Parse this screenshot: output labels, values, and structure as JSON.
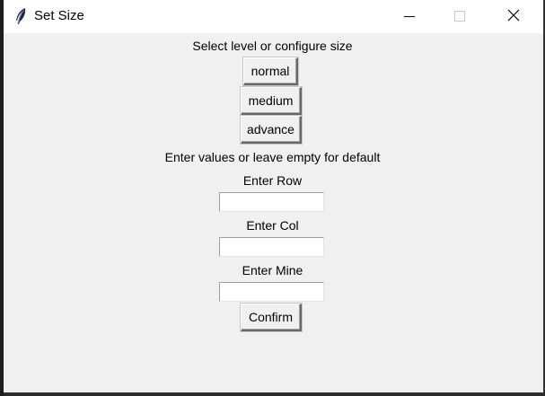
{
  "window": {
    "title": "Set Size",
    "app_icon": "feather-icon",
    "controls": {
      "minimize": "minimize-icon",
      "maximize": "maximize-icon",
      "close": "close-icon"
    }
  },
  "main": {
    "level_prompt": "Select level or configure size",
    "levels": {
      "normal": "normal",
      "medium": "medium",
      "advance": "advance"
    },
    "values_prompt": "Enter values or leave empty for default",
    "row": {
      "label": "Enter Row",
      "value": ""
    },
    "col": {
      "label": "Enter Col",
      "value": ""
    },
    "mine": {
      "label": "Enter Mine",
      "value": ""
    },
    "confirm_label": "Confirm"
  }
}
